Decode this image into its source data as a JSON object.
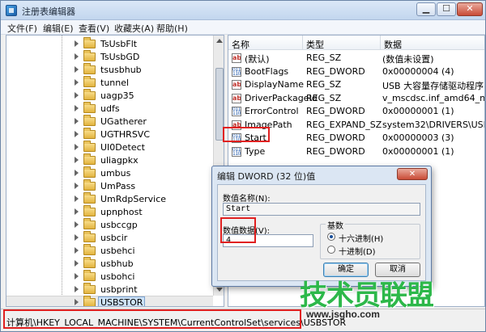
{
  "window": {
    "title": "注册表编辑器"
  },
  "menu": [
    "文件(F)",
    "编辑(E)",
    "查看(V)",
    "收藏夹(A)",
    "帮助(H)"
  ],
  "tree": {
    "items": [
      "TsUsbFlt",
      "TsUsbGD",
      "tsusbhub",
      "tunnel",
      "uagp35",
      "udfs",
      "UGatherer",
      "UGTHRSVC",
      "UI0Detect",
      "uliagpkx",
      "umbus",
      "UmPass",
      "UmRdpService",
      "upnphost",
      "usbccgp",
      "usbcir",
      "usbehci",
      "usbhub",
      "usbohci",
      "usbprint",
      "USBSTOR"
    ],
    "selected_index": 20
  },
  "values": {
    "columns": [
      "名称",
      "类型",
      "数据"
    ],
    "rows": [
      {
        "icon": "ab",
        "name": "(默认)",
        "type": "REG_SZ",
        "data": "(数值未设置)"
      },
      {
        "icon": "dword",
        "name": "BootFlags",
        "type": "REG_DWORD",
        "data": "0x00000004 (4)"
      },
      {
        "icon": "ab",
        "name": "DisplayName",
        "type": "REG_SZ",
        "data": "USB 大容量存储驱动程序"
      },
      {
        "icon": "ab",
        "name": "DriverPackageId",
        "type": "REG_SZ",
        "data": "v_mscdsc.inf_amd64_neutra"
      },
      {
        "icon": "dword",
        "name": "ErrorControl",
        "type": "REG_DWORD",
        "data": "0x00000001 (1)"
      },
      {
        "icon": "ab",
        "name": "ImagePath",
        "type": "REG_EXPAND_SZ",
        "data": "system32\\DRIVERS\\USBSTO"
      },
      {
        "icon": "dword",
        "name": "Start",
        "type": "REG_DWORD",
        "data": "0x00000003 (3)"
      },
      {
        "icon": "dword",
        "name": "Type",
        "type": "REG_DWORD",
        "data": "0x00000001 (1)"
      }
    ]
  },
  "status": {
    "path": "计算机\\HKEY_LOCAL_MACHINE\\SYSTEM\\CurrentControlSet\\services\\USBSTOR"
  },
  "dialog": {
    "title": "编辑 DWORD (32 位)值",
    "value_name_label": "数值名称(N):",
    "value_name": "Start",
    "value_data_label": "数值数据(V):",
    "value_data": "4",
    "base_label": "基数",
    "hex_label": "十六进制(H)",
    "dec_label": "十进制(D)",
    "ok_label": "确定",
    "cancel_label": "取消"
  },
  "watermark": {
    "text": "技术员联盟",
    "url": "www.jsgho.com"
  },
  "colors": {
    "highlight": "#e02020",
    "watermark": "#2db84a"
  }
}
